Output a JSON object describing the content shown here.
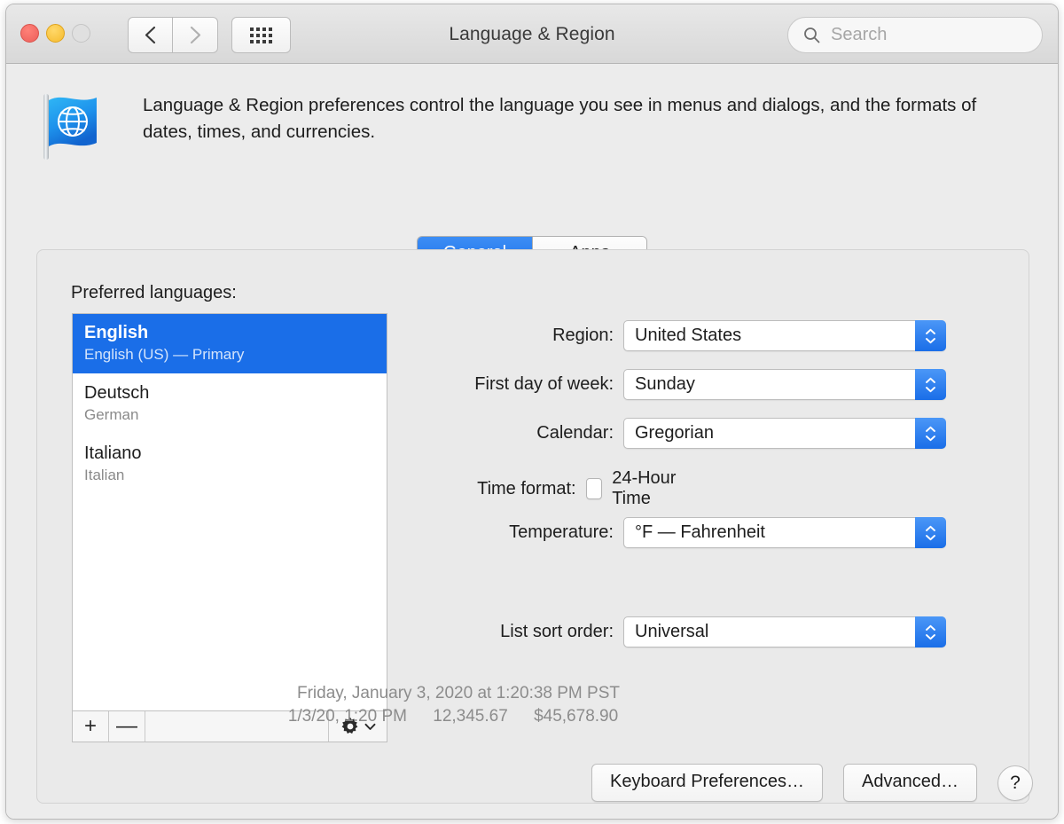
{
  "window": {
    "title": "Language & Region",
    "traffic_lights": [
      "close",
      "minimize",
      "zoom"
    ]
  },
  "toolbar": {
    "back_icon": "chevron-left-icon",
    "forward_icon": "chevron-right-icon",
    "showall_icon": "grid-icon",
    "search": {
      "placeholder": "Search",
      "value": "",
      "icon": "search-icon"
    }
  },
  "banner": {
    "icon": "globe-flag-icon",
    "text": "Language & Region preferences control the language you see in menus and dialogs, and the formats of dates, times, and currencies."
  },
  "tabs": [
    {
      "label": "General",
      "active": true
    },
    {
      "label": "Apps",
      "active": false
    }
  ],
  "languages": {
    "heading": "Preferred languages:",
    "items": [
      {
        "primary": "English",
        "secondary": "English (US) — Primary",
        "selected": true
      },
      {
        "primary": "Deutsch",
        "secondary": "German",
        "selected": false
      },
      {
        "primary": "Italiano",
        "secondary": "Italian",
        "selected": false
      }
    ],
    "toolbar": {
      "add_label": "+",
      "remove_label": "—",
      "gear_icon": "gear-icon",
      "gear_chevron_icon": "chevron-down-icon"
    }
  },
  "settings": {
    "region": {
      "label": "Region:",
      "value": "United States"
    },
    "first_day": {
      "label": "First day of week:",
      "value": "Sunday"
    },
    "calendar": {
      "label": "Calendar:",
      "value": "Gregorian"
    },
    "time_format": {
      "label": "Time format:",
      "checkbox_label": "24-Hour Time",
      "checked": false
    },
    "temperature": {
      "label": "Temperature:",
      "value": "°F — Fahrenheit"
    },
    "sort_order": {
      "label": "List sort order:",
      "value": "Universal"
    }
  },
  "preview": {
    "long_date": "Friday, January 3, 2020 at 1:20:38 PM PST",
    "short_date": "1/3/20, 1:20 PM",
    "number": "12,345.67",
    "currency": "$45,678.90"
  },
  "footer": {
    "keyboard_prefs": "Keyboard Preferences…",
    "advanced": "Advanced…",
    "help": "?"
  },
  "colors": {
    "accent_blue": "#1a6ee8",
    "window_bg": "#ececec",
    "panel_bg": "#eaeaea",
    "muted_text": "#8a8a8a"
  }
}
